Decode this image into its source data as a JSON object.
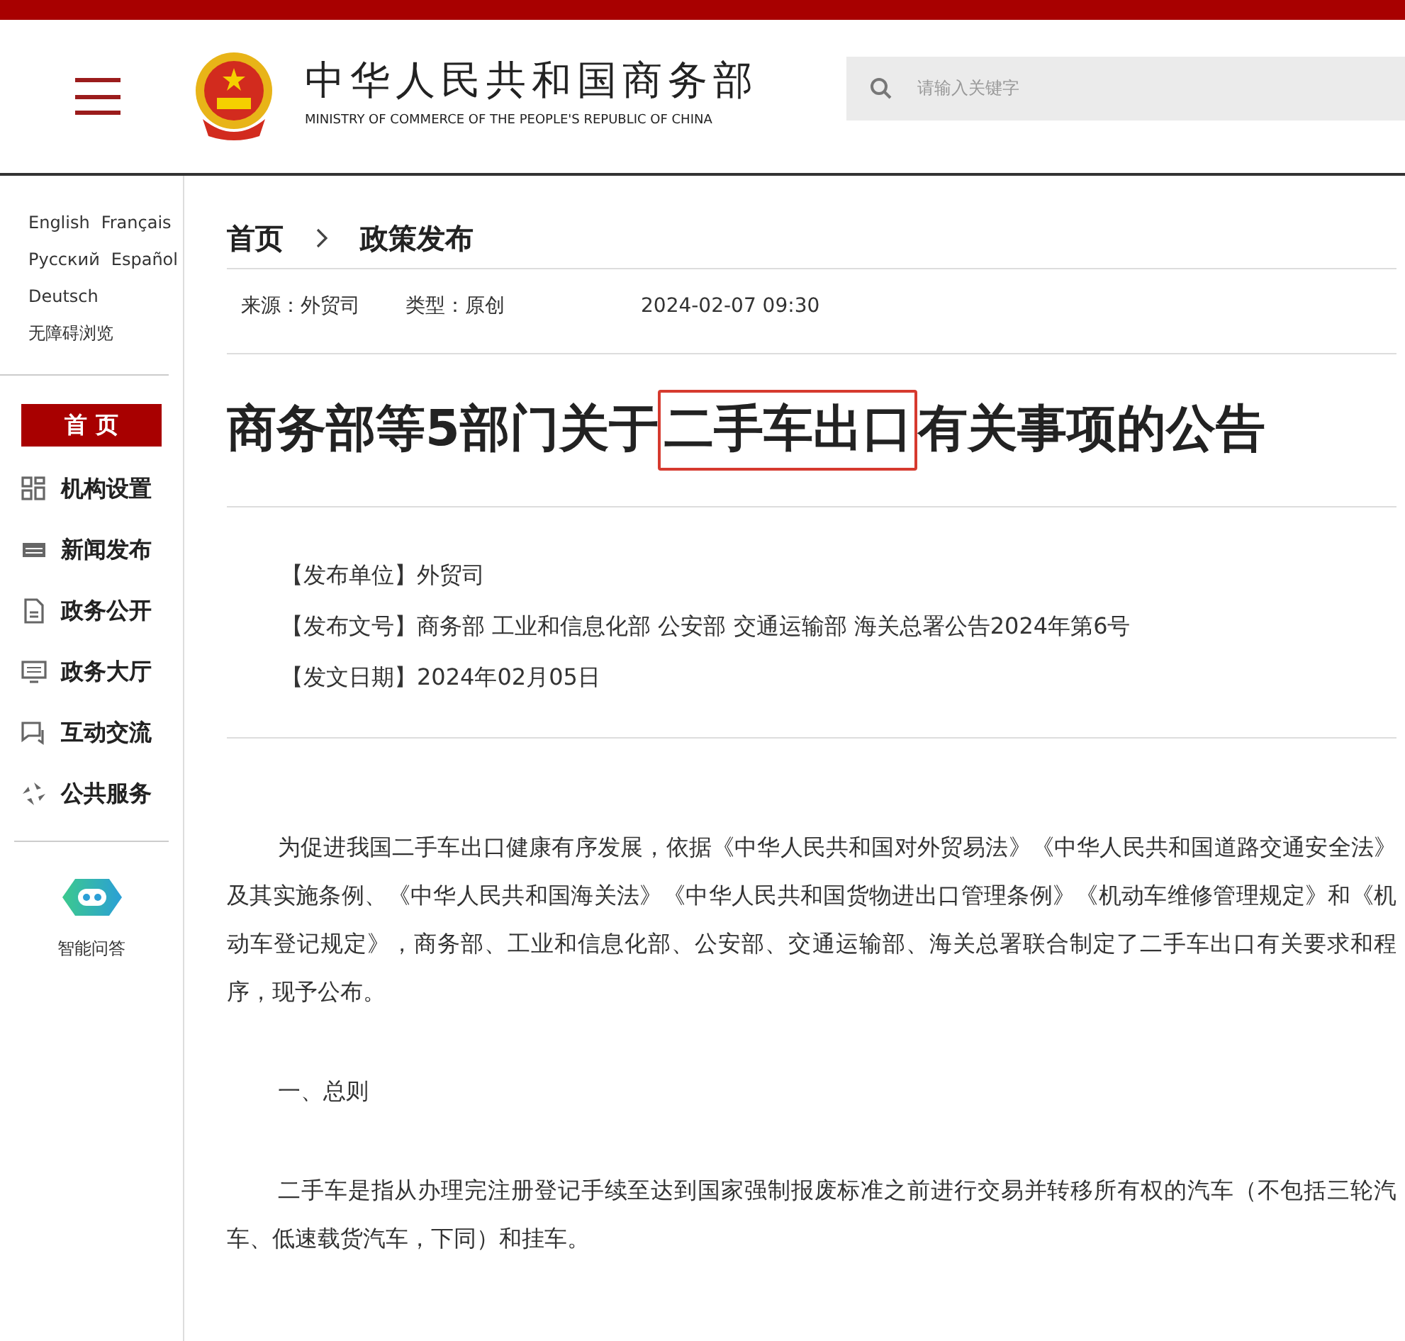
{
  "header": {
    "title": "中华人民共和国商务部",
    "subtitle": "MINISTRY OF COMMERCE OF THE PEOPLE'S REPUBLIC OF CHINA",
    "search": {
      "placeholder": "请输入关键字"
    }
  },
  "sidebar": {
    "languages": [
      [
        "English",
        "Français"
      ],
      [
        "Русский",
        "Español"
      ],
      [
        "Deutsch"
      ]
    ],
    "accessibility": "无障碍浏览",
    "home": "首 页",
    "items": [
      {
        "kind": "grid",
        "label": "机构设置"
      },
      {
        "kind": "news",
        "label": "新闻发布"
      },
      {
        "kind": "document",
        "label": "政务公开"
      },
      {
        "kind": "monitor",
        "label": "政务大厅"
      },
      {
        "kind": "chat",
        "label": "互动交流"
      },
      {
        "kind": "service",
        "label": "公共服务"
      }
    ],
    "assistant": "智能问答"
  },
  "breadcrumb": [
    "首页",
    "政策发布"
  ],
  "meta": [
    "来源：外贸司",
    "类型：原创",
    "2024-02-07 09:30"
  ],
  "article": {
    "title": {
      "before": "商务部等5部门关于",
      "highlight": "二手车出口",
      "after": "有关事项的公告"
    },
    "info": [
      "【发布单位】外贸司",
      "【发布文号】商务部 工业和信息化部 公安部 交通运输部 海关总署公告2024年第6号",
      "【发文日期】2024年02月05日"
    ],
    "paragraphs": [
      {
        "kind": "body",
        "text": "为促进我国二手车出口健康有序发展，依据《中华人民共和国对外贸易法》《中华人民共和国道路交通安全法》及其实施条例、《中华人民共和国海关法》《中华人民共和国货物进出口管理条例》《机动车维修管理规定》和《机动车登记规定》，商务部、工业和信息化部、公安部、交通运输部、海关总署联合制定了二手车出口有关要求和程序，现予公布。"
      },
      {
        "kind": "heading",
        "text": "一、总则"
      },
      {
        "kind": "body",
        "text": "二手车是指从办理完注册登记手续至达到国家强制报废标准之前进行交易并转移所有权的汽车（不包括三轮汽车、低速载货汽车，下同）和挂车。"
      }
    ]
  }
}
